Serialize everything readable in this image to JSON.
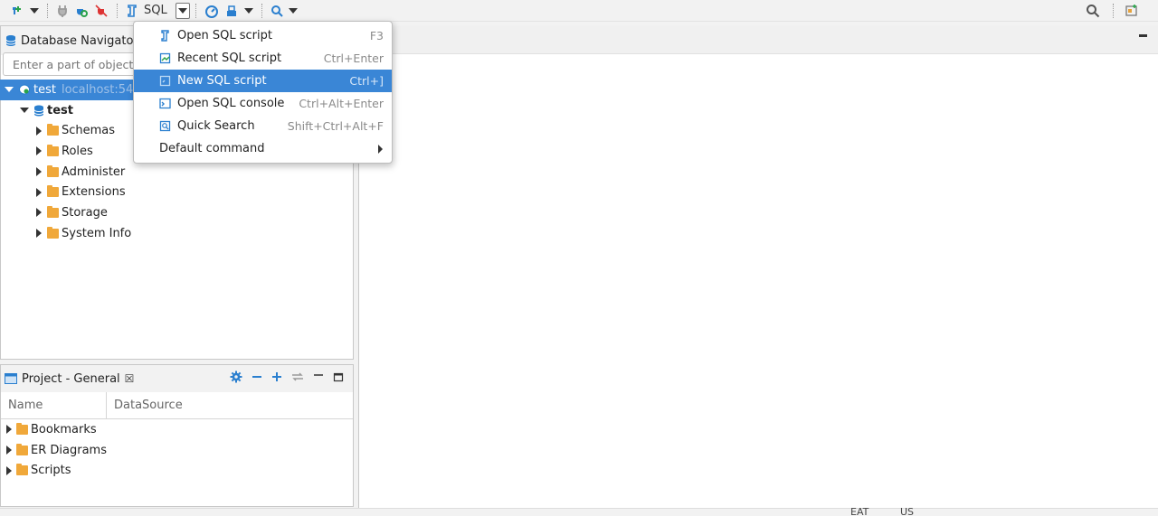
{
  "toolbar": {
    "sql_label": "SQL"
  },
  "navigator": {
    "title": "Database Navigator",
    "filter_placeholder": "Enter a part of object n",
    "connection": {
      "label": "test",
      "host": "localhost:54"
    },
    "database": "test",
    "items": [
      "Schemas",
      "Roles",
      "Administer",
      "Extensions",
      "Storage",
      "System Info"
    ]
  },
  "project": {
    "title": "Project - General",
    "close_glyph": "☒",
    "columns": [
      "Name",
      "DataSource"
    ],
    "items": [
      "Bookmarks",
      "ER Diagrams",
      "Scripts"
    ]
  },
  "menu": {
    "items": [
      {
        "label": "Open SQL script",
        "shortcut": "F3"
      },
      {
        "label": "Recent SQL script",
        "shortcut": "Ctrl+Enter"
      },
      {
        "label": "New SQL script",
        "shortcut": "Ctrl+]"
      },
      {
        "label": "Open SQL console",
        "shortcut": "Ctrl+Alt+Enter"
      },
      {
        "label": "Quick Search",
        "shortcut": "Shift+Ctrl+Alt+F"
      },
      {
        "label": "Default command",
        "shortcut": ""
      }
    ],
    "highlighted_index": 2
  },
  "status": {
    "left": "EAT",
    "right": "US"
  },
  "colors": {
    "accent": "#3a86d6",
    "folder": "#f0a83a",
    "icon_blue": "#2a7fcf"
  }
}
